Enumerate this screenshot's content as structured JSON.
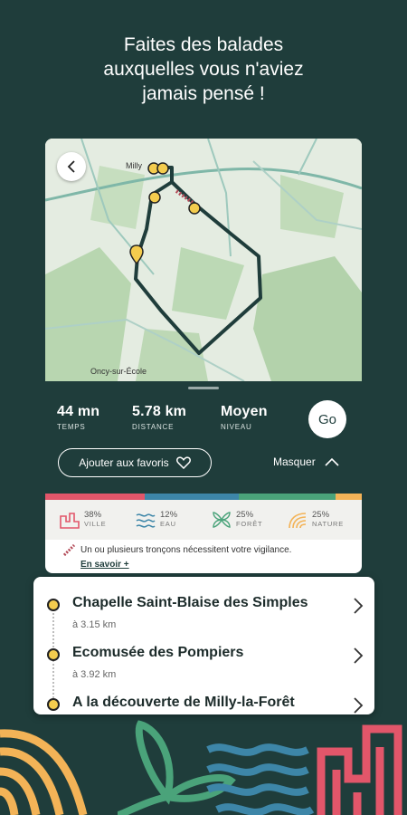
{
  "headline": {
    "line1": "Faites des balades",
    "line2": "auxquelles vous n'aviez",
    "line3": "jamais pensé !"
  },
  "map": {
    "town_top": "Milly",
    "town_bottom": "Oncy-sur-École"
  },
  "stats": {
    "time": {
      "value": "44 mn",
      "label": "TEMPS"
    },
    "distance": {
      "value": "5.78 km",
      "label": "DISTANCE"
    },
    "level": {
      "value": "Moyen",
      "label": "NIVEAU"
    },
    "go_label": "Go"
  },
  "actions": {
    "favorite_label": "Ajouter aux favoris",
    "hide_label": "Masquer"
  },
  "landscape": {
    "bar_colors": [
      "#e2566a",
      "#3d86a8",
      "#4aa37a",
      "#f3b357"
    ],
    "items": [
      {
        "pct": "38%",
        "name": "VILLE",
        "icon": "city-icon",
        "color": "#e2566a"
      },
      {
        "pct": "12%",
        "name": "EAU",
        "icon": "water-icon",
        "color": "#3d86a8"
      },
      {
        "pct": "25%",
        "name": "FORÊT",
        "icon": "forest-icon",
        "color": "#4aa37a"
      },
      {
        "pct": "25%",
        "name": "NATURE",
        "icon": "nature-icon",
        "color": "#f3b357"
      }
    ]
  },
  "warning": {
    "text": "Un ou plusieurs tronçons nécessitent votre vigilance.",
    "link": "En savoir +"
  },
  "pois": [
    {
      "title": "Chapelle Saint-Blaise des Simples",
      "distance": "à 3.15 km"
    },
    {
      "title": "Ecomusée des Pompiers",
      "distance": "à 3.92 km"
    },
    {
      "title": "A la découverte de Milly-la-Forêt",
      "distance": ""
    }
  ],
  "colors": {
    "background": "#1f3d3b",
    "accent_yellow": "#f4cc4e",
    "route": "#1f3d3b"
  }
}
